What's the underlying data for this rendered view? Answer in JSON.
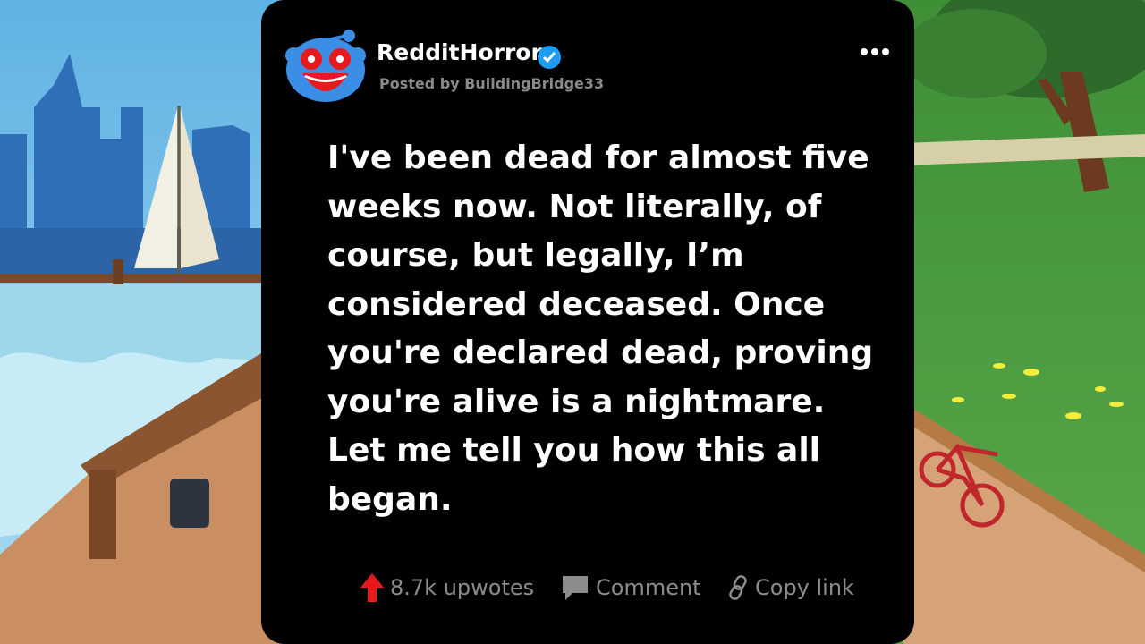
{
  "post": {
    "subreddit": "RedditHorror",
    "posted_by": "Posted by BuildingBridge33",
    "story_lines": [
      "I've been dead for almost five",
      "weeks now. Not literally, of",
      "course, but legally, I’m",
      "considered deceased. Once",
      "you're declared dead, proving",
      "you're alive is a nightmare.",
      "Let me tell you how this all",
      "began."
    ]
  },
  "actions": {
    "upvotes": "8.7k upwotes",
    "comment": "Comment",
    "copy_link": "Copy link"
  },
  "icons": {
    "avatar": "reddit-snoo-red-eyes",
    "verified": "verified-badge",
    "more": "more-dots",
    "upvote": "red-up-arrow",
    "comment": "speech-bubble",
    "link": "chain-link"
  },
  "colors": {
    "card_bg": "#000000",
    "text": "#ffffff",
    "muted": "#8c8c8c",
    "upvote_red": "#e8191b",
    "verified_blue": "#1d9bf0",
    "avatar_blue": "#3a8ee6"
  }
}
